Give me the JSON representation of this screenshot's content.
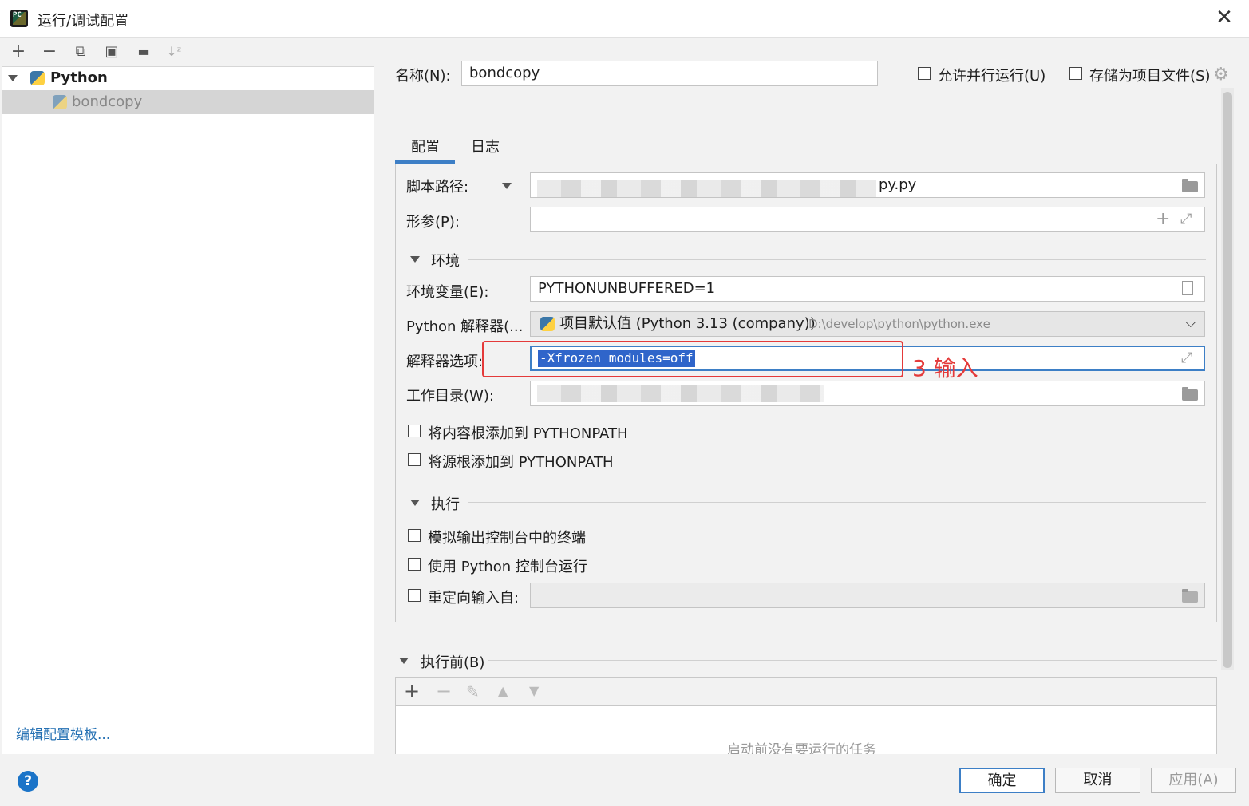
{
  "window": {
    "title": "运行/调试配置",
    "app_icon": "PC"
  },
  "left": {
    "toolbar": [
      {
        "name": "add-icon",
        "glyph": "+"
      },
      {
        "name": "remove-icon",
        "glyph": "−"
      },
      {
        "name": "copy-icon",
        "glyph": "⧉"
      },
      {
        "name": "save-icon",
        "glyph": "▣"
      },
      {
        "name": "new-folder-icon",
        "glyph": "▬"
      },
      {
        "name": "sort-icon",
        "glyph": "↓ᶻ"
      }
    ],
    "tree_group": "Python",
    "tree_item": "bondcopy",
    "edit_templates": "编辑配置模板..."
  },
  "header": {
    "name_label": "名称(N):",
    "name_value": "bondcopy",
    "allow_parallel": "允许并行运行(U)",
    "store_as_project": "存储为项目文件(S)"
  },
  "tabs": [
    "配置",
    "日志"
  ],
  "config": {
    "script_label": "脚本路径:",
    "script_value": "py.py",
    "params_label": "形参(P):",
    "env_section": "环境",
    "env_vars_label": "环境变量(E):",
    "env_vars_value": "PYTHONUNBUFFERED=1",
    "interp_label": "Python 解释器(...",
    "interp_value": "项目默认值 (Python 3.13 (company))",
    "interp_path": "D:\\develop\\python\\python.exe",
    "interp_options_label": "解释器选项:",
    "interp_options_value": "-Xfrozen_modules=off",
    "annotation": "3 输入",
    "workdir_label": "工作目录(W):",
    "add_content_roots": "将内容根添加到 PYTHONPATH",
    "add_source_roots": "将源根添加到 PYTHONPATH",
    "exec_section": "执行",
    "emulate_terminal": "模拟输出控制台中的终端",
    "use_console": "使用 Python 控制台运行",
    "redirect_input": "重定向输入自:"
  },
  "before_launch": {
    "label": "执行前(B)",
    "empty_text": "启动前没有要运行的任务"
  },
  "footer": {
    "ok": "确定",
    "cancel": "取消",
    "apply": "应用(A)",
    "help": "?"
  }
}
